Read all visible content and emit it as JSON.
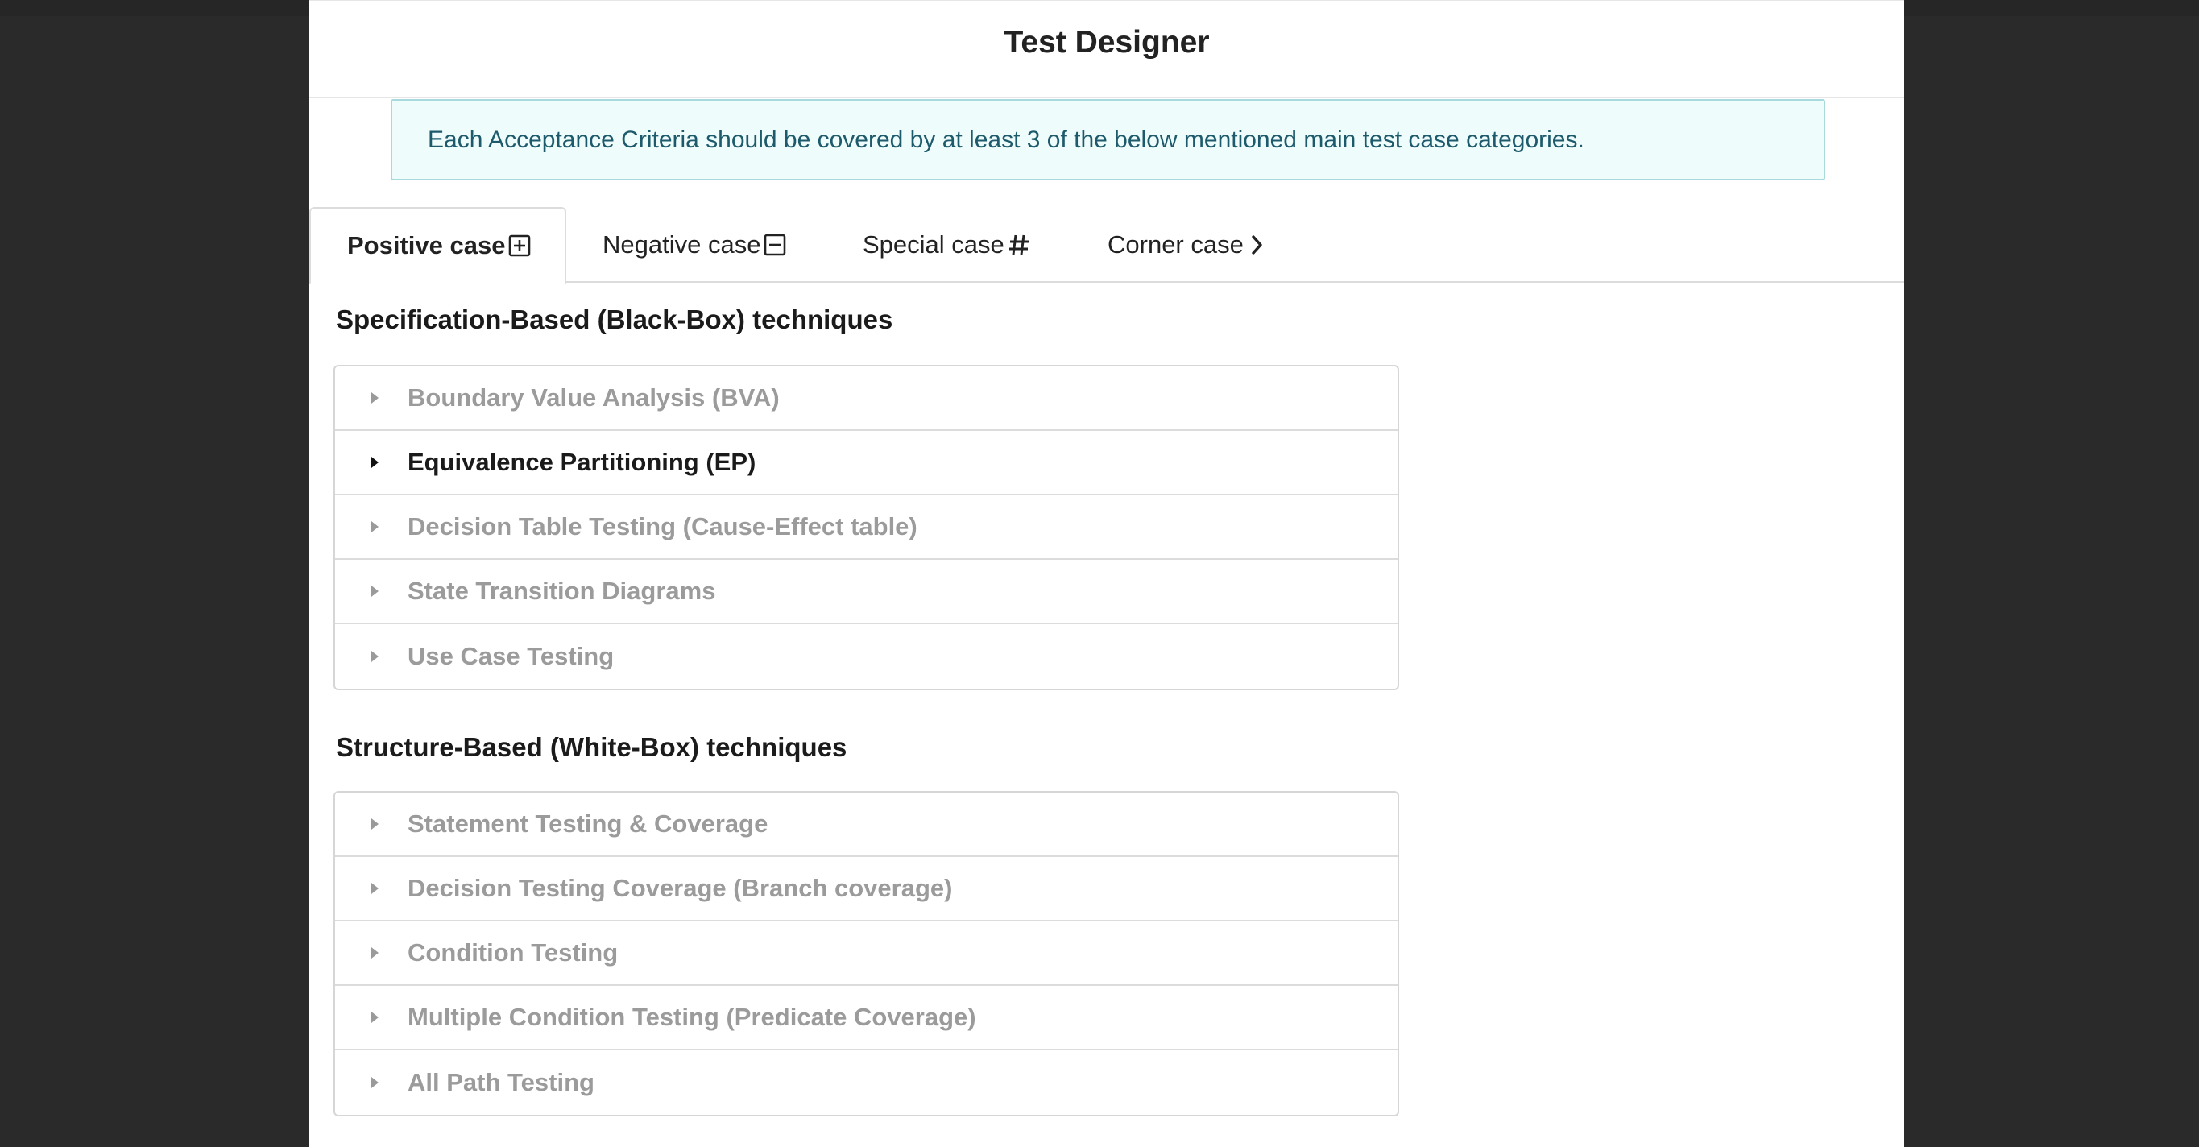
{
  "modal": {
    "title": "Test Designer",
    "info_text": "Each Acceptance Criteria should be covered by at least 3 of the below mentioned main test case categories."
  },
  "tabs": [
    {
      "label": "Positive case",
      "icon": "plus-square-icon",
      "active": true
    },
    {
      "label": "Negative case",
      "icon": "minus-square-icon",
      "active": false
    },
    {
      "label": "Special case",
      "icon": "hash-icon",
      "active": false
    },
    {
      "label": "Corner case",
      "icon": "chevron-right-icon",
      "active": false
    }
  ],
  "sections": [
    {
      "title": "Specification-Based (Black-Box) techniques",
      "items": [
        {
          "label": "Boundary Value Analysis (BVA)",
          "active": false
        },
        {
          "label": "Equivalence Partitioning (EP)",
          "active": true
        },
        {
          "label": "Decision Table Testing (Cause-Effect table)",
          "active": false
        },
        {
          "label": "State Transition Diagrams",
          "active": false
        },
        {
          "label": "Use Case Testing",
          "active": false
        }
      ]
    },
    {
      "title": "Structure-Based (White-Box) techniques",
      "items": [
        {
          "label": "Statement Testing & Coverage",
          "active": false
        },
        {
          "label": "Decision Testing Coverage (Branch coverage)",
          "active": false
        },
        {
          "label": "Condition Testing",
          "active": false
        },
        {
          "label": "Multiple Condition Testing (Predicate Coverage)",
          "active": false
        },
        {
          "label": "All Path Testing",
          "active": false
        }
      ]
    }
  ],
  "colors": {
    "backdrop": "#2a2a2a",
    "banner_bg": "#effcfc",
    "banner_border": "#a8dadd",
    "banner_text": "#1d5a6b",
    "muted_text": "#9b9b9b"
  }
}
